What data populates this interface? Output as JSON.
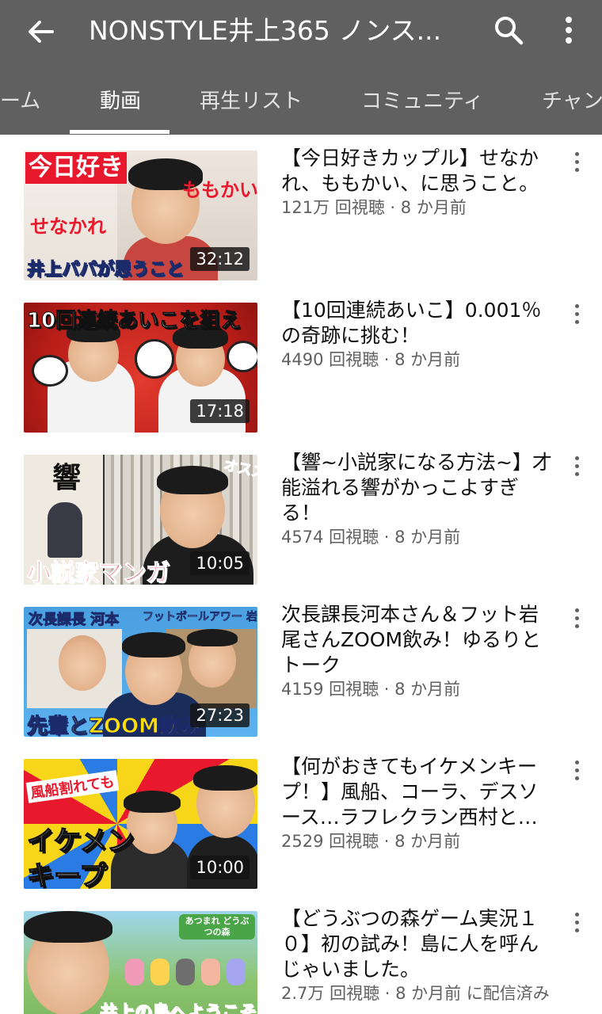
{
  "header": {
    "title": "NONSTYLE井上365 ノンス...",
    "background": "#606060"
  },
  "tabs": [
    {
      "label": "ーム",
      "active": false
    },
    {
      "label": "動画",
      "active": true
    },
    {
      "label": "再生リスト",
      "active": false
    },
    {
      "label": "コミュニティ",
      "active": false
    },
    {
      "label": "チャン",
      "active": false
    }
  ],
  "videos": [
    {
      "title": "【今日好きカップル】せなかれ、ももかい、に思うこと。",
      "meta": "121万 回視聴 · 8 か月前",
      "duration": "32:12",
      "thumb_text": [
        "今日好き",
        "ももかい",
        "せなかれ",
        "井上パパが思うこと"
      ]
    },
    {
      "title": "【10回連続あいこ】0.001％の奇跡に挑む！",
      "meta": "4490 回視聴 · 8 か月前",
      "duration": "17:18",
      "thumb_text": [
        "10回連続あいこを狙え"
      ]
    },
    {
      "title": "【響~小説家になる方法~】才能溢れる響がかっこよすぎる！",
      "meta": "4574 回視聴 · 8 か月前",
      "duration": "10:05",
      "thumb_text": [
        "響",
        "オススメ",
        "小説家マンガ"
      ]
    },
    {
      "title": "次長課長河本さん＆フット岩尾さんZOOM飲み！ゆるりとトーク",
      "meta": "4159 回視聴 · 8 か月前",
      "duration": "27:23",
      "thumb_text": [
        "次長課長 河本",
        "フットボールアワー 岩尾",
        "先輩とZOOM飲み"
      ]
    },
    {
      "title": "【何がおきてもイケメンキープ！】風船、コーラ、デスソース…ラフレクラン西村と男…",
      "meta": "2529 回視聴 · 8 か月前",
      "duration": "10:00",
      "thumb_text": [
        "風船割れても",
        "イケメン",
        "キープ"
      ]
    },
    {
      "title": "【どうぶつの森ゲーム実況１０】初の試み！島に人を呼んじゃいました。",
      "meta": "2.7万 回視聴 · 8 か月前 に配信済み",
      "duration": "",
      "thumb_text": [
        "あつまれ どうぶつの森",
        "井上の島へようこそ"
      ]
    }
  ]
}
